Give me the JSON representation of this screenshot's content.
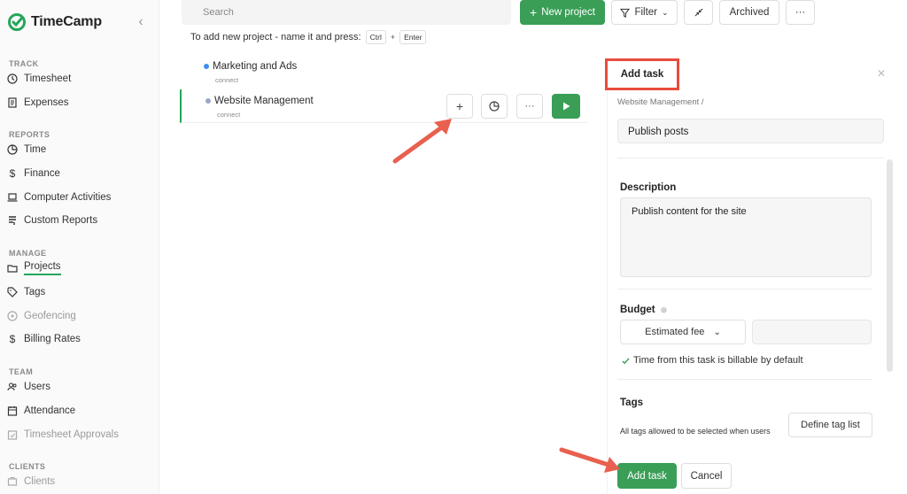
{
  "app": {
    "name": "TimeCamp"
  },
  "sidebar": {
    "sections": [
      {
        "title": "TRACK",
        "items": [
          {
            "label": "Timesheet",
            "icon": "clock-icon"
          },
          {
            "label": "Expenses",
            "icon": "receipt-icon"
          }
        ]
      },
      {
        "title": "REPORTS",
        "items": [
          {
            "label": "Time",
            "icon": "pie-icon"
          },
          {
            "label": "Finance",
            "icon": "dollar-icon"
          },
          {
            "label": "Computer Activities",
            "icon": "laptop-icon"
          },
          {
            "label": "Custom Reports",
            "icon": "report-icon"
          }
        ]
      },
      {
        "title": "MANAGE",
        "items": [
          {
            "label": "Projects",
            "icon": "folder-icon",
            "active": true
          },
          {
            "label": "Tags",
            "icon": "tag-icon"
          },
          {
            "label": "Geofencing",
            "icon": "geofence-icon",
            "disabled": true
          },
          {
            "label": "Billing Rates",
            "icon": "dollar-icon"
          }
        ]
      },
      {
        "title": "TEAM",
        "items": [
          {
            "label": "Users",
            "icon": "users-icon"
          },
          {
            "label": "Attendance",
            "icon": "calendar-icon"
          },
          {
            "label": "Timesheet Approvals",
            "icon": "approval-icon",
            "disabled": true
          }
        ]
      },
      {
        "title": "CLIENTS",
        "items": [
          {
            "label": "Clients",
            "icon": "client-icon",
            "disabled": true
          }
        ]
      }
    ]
  },
  "toolbar": {
    "search_placeholder": "Search",
    "new_project": "New project",
    "filter": "Filter",
    "archived": "Archived",
    "more": "···"
  },
  "hint": {
    "text": "To add new project - name it and press:",
    "key1": "Ctrl",
    "plus": "+",
    "key2": "Enter"
  },
  "projects": [
    {
      "name": "Marketing and Ads",
      "sub": "connect",
      "color": "#3d8ef0"
    },
    {
      "name": "Website Management",
      "sub": "connect",
      "color": "#9aa7c7"
    }
  ],
  "row_actions": {
    "add": "+",
    "more": "···"
  },
  "panel": {
    "title": "Add task",
    "breadcrumb": "Website Management /",
    "task_name": "Publish posts",
    "description_label": "Description",
    "description_value": "Publish content for the site",
    "budget_label": "Budget",
    "budget_type": "Estimated fee",
    "billable_text": "Time from this task is billable by default",
    "tags_label": "Tags",
    "tags_hint": "All tags allowed to be selected when users",
    "define_tags": "Define tag list",
    "add_button": "Add task",
    "cancel_button": "Cancel"
  },
  "colors": {
    "accent": "#3a9e57",
    "highlight": "#e84c3d"
  }
}
